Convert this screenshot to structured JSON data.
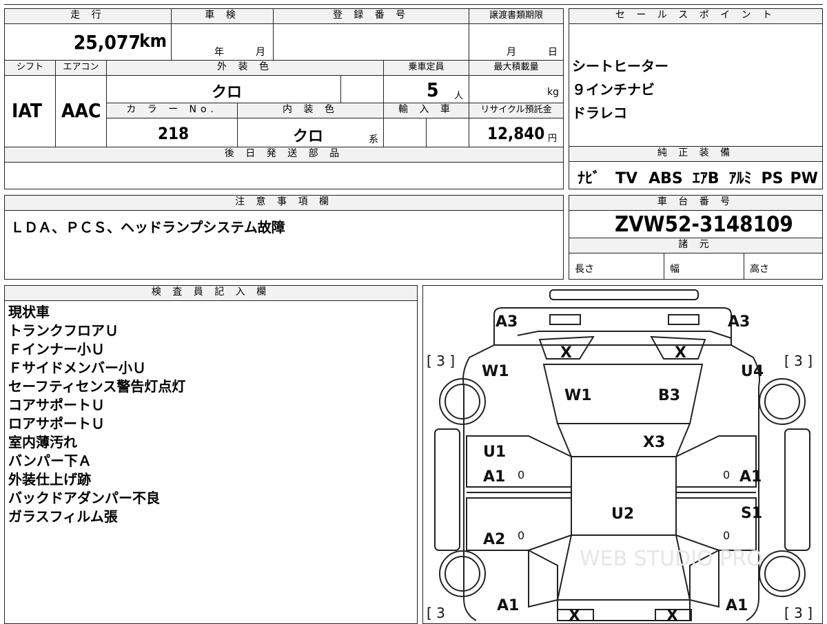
{
  "info_table": {
    "mileage_label": "走 行",
    "mileage_value": "25,077",
    "mileage_unit": "km",
    "shaken_label": "車 検",
    "shaken_year": "年",
    "shaken_month": "月",
    "registration_label": "登 録 番 号",
    "transfer_label": "譲渡書類期限",
    "transfer_month": "月",
    "transfer_day": "日",
    "shift_label": "シフト",
    "shift_value": "IAT",
    "aircon_label": "エアコン",
    "aircon_value": "AAC",
    "exterior_label": "外 装 色",
    "exterior_value": "クロ",
    "capacity_label": "乗車定員",
    "capacity_value": "5",
    "capacity_unit": "人",
    "maxload_label": "最大積載量",
    "maxload_unit": "kg",
    "color_no_label": "カ ラ ー No.",
    "color_no_value": "218",
    "interior_label": "内 装 色",
    "interior_value": "クロ",
    "interior_suffix": "系",
    "import_label": "輸 入 車",
    "recycle_label": "リサイクル預託金",
    "recycle_value": "12,840",
    "recycle_unit": "円",
    "later_parts_label": "後 日 発 送 部 品"
  },
  "sales_points": {
    "label": "セ ー ル ス ポ イ ン ト",
    "items": [
      "シートヒーター",
      "９インチナビ",
      "ドラレコ"
    ]
  },
  "genuine_equipment": {
    "label": "純 正 装 備",
    "items": [
      "ﾅﾋﾞ",
      "TV",
      "ABS",
      "ｴｱB",
      "ｱﾙﾐ",
      "PS",
      "PW"
    ]
  },
  "notes": {
    "label": "注 意 事 項 欄",
    "text": "ＬＤＡ、ＰＣＳ、ヘッドランプシステム故障"
  },
  "chassis": {
    "label": "車 台 番 号",
    "value": "ZVW52-3148109",
    "spec_label": "諸 元",
    "length_label": "長さ",
    "width_label": "幅",
    "height_label": "高さ"
  },
  "inspector": {
    "label": "検 査 員 記 入 欄",
    "lines": [
      "現状車",
      "トランクフロアＵ",
      "Ｆインナー小Ｕ",
      "Ｆサイドメンバー小Ｕ",
      "セーフティセンス警告灯点灯",
      "コアサポートＵ",
      "ロアサポートＵ",
      "室内薄汚れ",
      "バンパー下Ａ",
      "外装仕上げ跡",
      "バックドアダンパー不良",
      "ガラスフィルム張"
    ]
  },
  "diagram": {
    "marks": {
      "rear_left": "A3",
      "rear_right": "A3",
      "rear_glass_left": "X",
      "rear_glass_right": "X",
      "left_quarter": "W1",
      "right_quarter": "U4",
      "rear_roof_left": "W1",
      "rear_roof_right": "B3",
      "roof_glass": "X3",
      "left_rear_door_1": "U1",
      "left_rear_door_2": "A1",
      "right_rear_door": "A1",
      "roof": "U2",
      "right_front_door": "S1",
      "left_front_door": "A2",
      "left_fender": "A1",
      "right_fender": "A1",
      "windshield_left": "X",
      "windshield_right": "X"
    },
    "tire_left_top": "[ 3 ]",
    "tire_right_top": "[ 3 ]",
    "tire_left_bottom": "[ 3",
    "tire_right_bottom": "[ 3 ]",
    "zero_marks": [
      "0",
      "0",
      "0",
      "0"
    ],
    "watermark": "WEB STUDIO PRO"
  }
}
